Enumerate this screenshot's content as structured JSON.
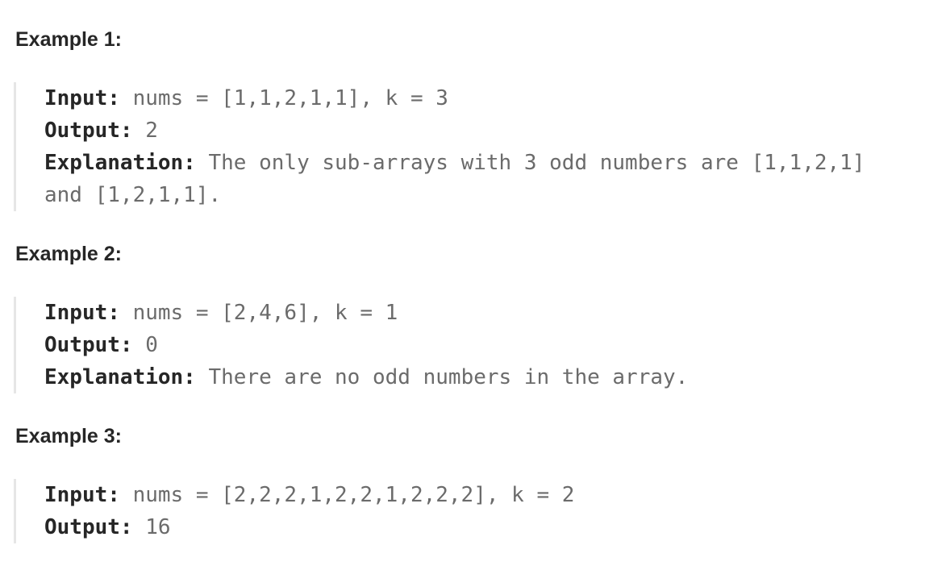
{
  "examples": [
    {
      "heading": "Example 1:",
      "lines": [
        {
          "label": "Input:",
          "value": " nums = [1,1,2,1,1], k = 3"
        },
        {
          "label": "Output:",
          "value": " 2"
        },
        {
          "label": "Explanation:",
          "value": " The only sub-arrays with 3 odd numbers are [1,1,2,1]"
        },
        {
          "label": "",
          "value": "and [1,2,1,1]."
        }
      ]
    },
    {
      "heading": "Example 2:",
      "lines": [
        {
          "label": "Input:",
          "value": " nums = [2,4,6], k = 1"
        },
        {
          "label": "Output:",
          "value": " 0"
        },
        {
          "label": "Explanation:",
          "value": " There are no odd numbers in the array."
        }
      ]
    },
    {
      "heading": "Example 3:",
      "lines": [
        {
          "label": "Input:",
          "value": " nums = [2,2,2,1,2,2,1,2,2,2], k = 2"
        },
        {
          "label": "Output:",
          "value": " 16"
        }
      ]
    }
  ]
}
